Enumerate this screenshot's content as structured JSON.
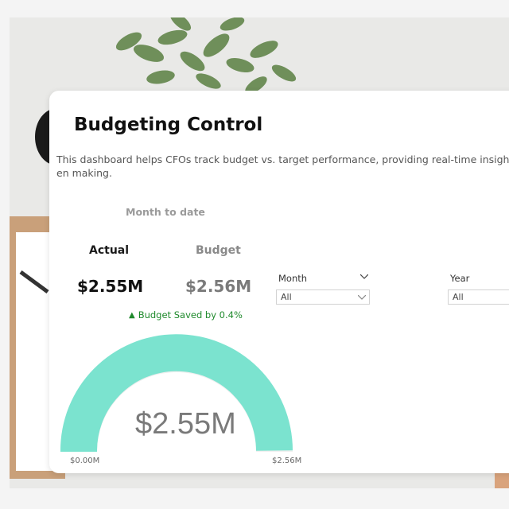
{
  "card": {
    "title": "Budgeting Control",
    "description": "This dashboard helps CFOs track budget vs. target performance, providing real-time insights to en making."
  },
  "kpi": {
    "period_label": "Month to date",
    "actual_label": "Actual",
    "budget_label": "Budget",
    "actual_value": "$2.55M",
    "budget_value": "$2.56M",
    "saved_text": "Budget Saved by 0.4%"
  },
  "filters": {
    "month": {
      "label": "Month",
      "value": "All"
    },
    "year": {
      "label": "Year",
      "value": "All"
    }
  },
  "gauge": {
    "value_text": "$2.55M",
    "min_text": "$0.00M",
    "max_text": "$2.56M",
    "value": 2.55,
    "max": 2.56,
    "fill_color": "#7be3cf"
  }
}
